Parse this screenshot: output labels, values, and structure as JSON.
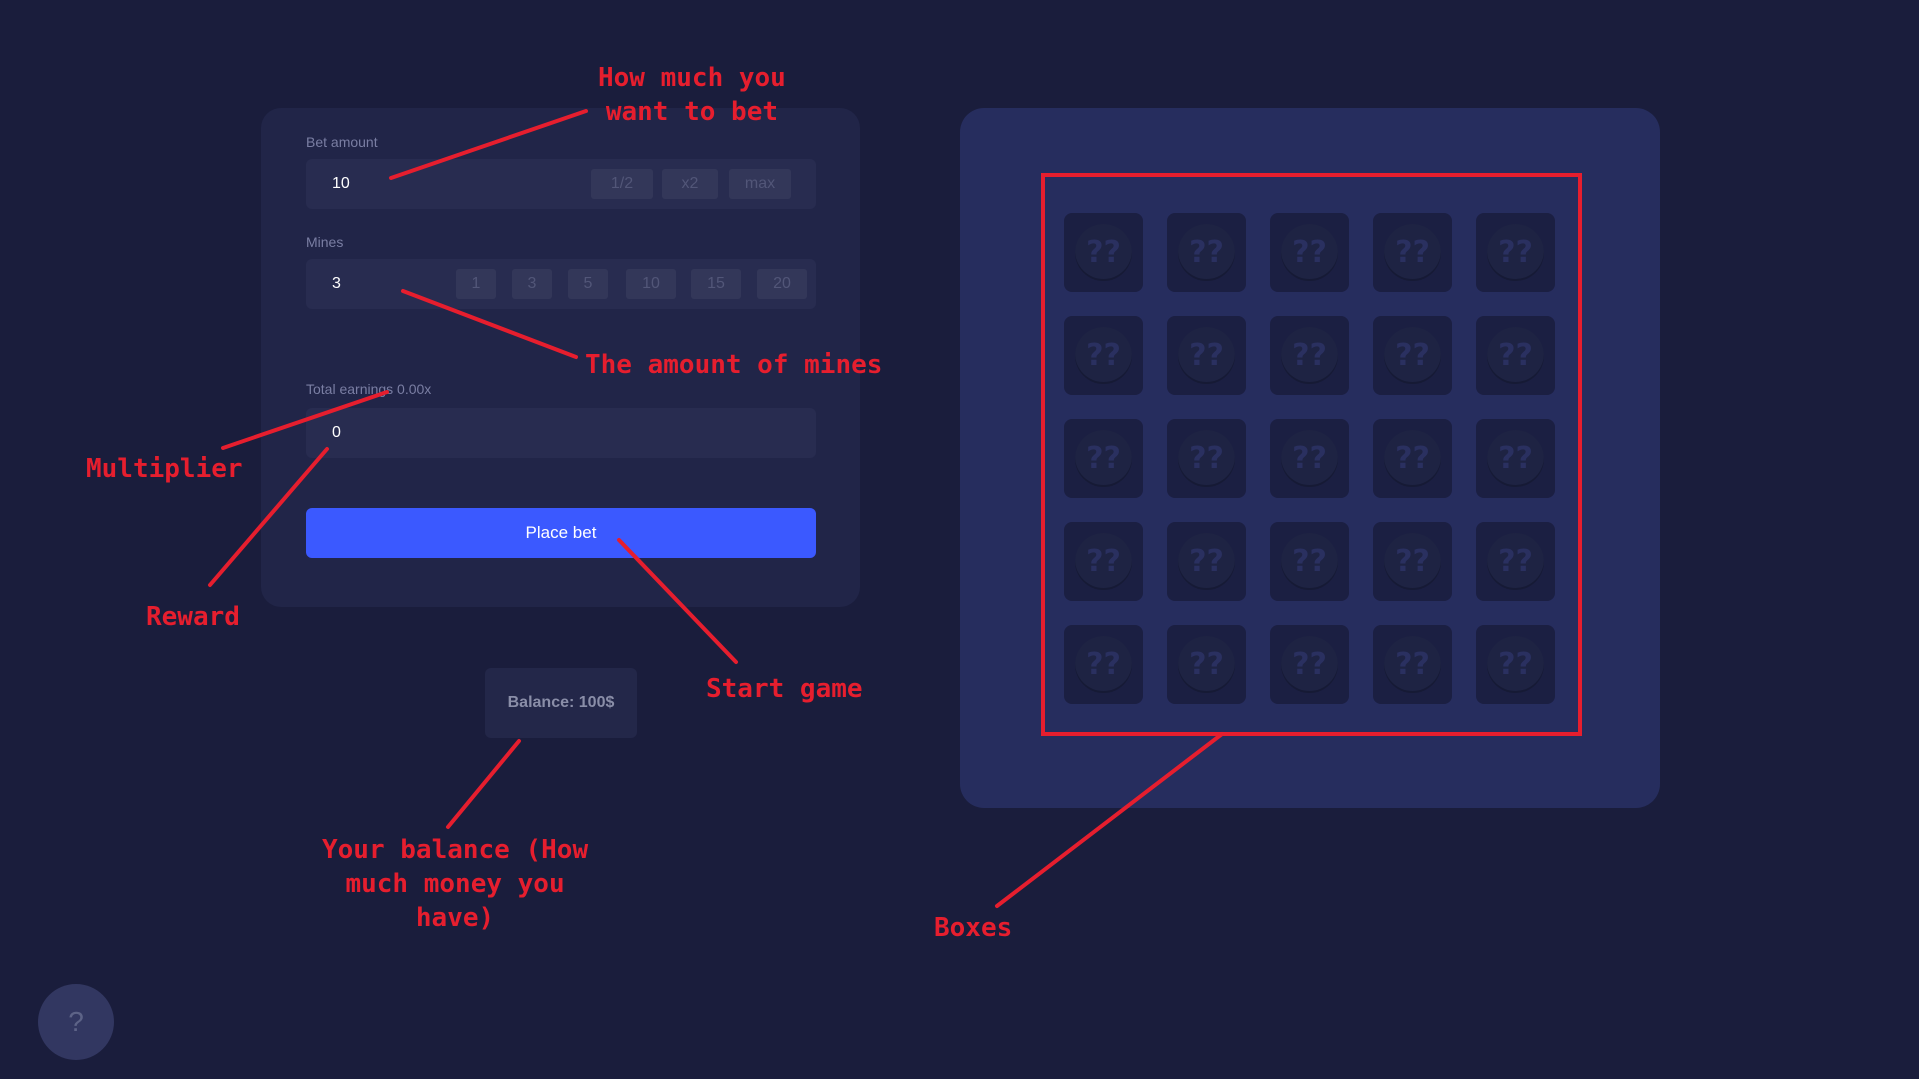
{
  "controls": {
    "bet_label": "Bet amount",
    "bet_value": "10",
    "bet_chips": [
      "1/2",
      "x2",
      "max"
    ],
    "mines_label": "Mines",
    "mines_value": "3",
    "mines_chips": [
      "1",
      "3",
      "5",
      "10",
      "15",
      "20"
    ],
    "earnings_label": "Total earnings 0.00x",
    "earnings_value": "0",
    "place_bet": "Place bet"
  },
  "balance": "Balance: 100$",
  "help_icon": "?",
  "board": {
    "rows": 5,
    "cols": 5,
    "box_glyph": "??"
  },
  "annotations": {
    "bet": [
      "How much you",
      "want to bet"
    ],
    "mines": "The amount of mines",
    "multiplier": "Multiplier",
    "reward": "Reward",
    "start": "Start game",
    "balance": [
      "Your balance (How",
      "much money you",
      "have)"
    ],
    "boxes": "Boxes"
  },
  "colors": {
    "background": "#1a1d3c",
    "panel": "#212548",
    "accent": "#3b59ff",
    "annotation": "#e61e2e"
  }
}
